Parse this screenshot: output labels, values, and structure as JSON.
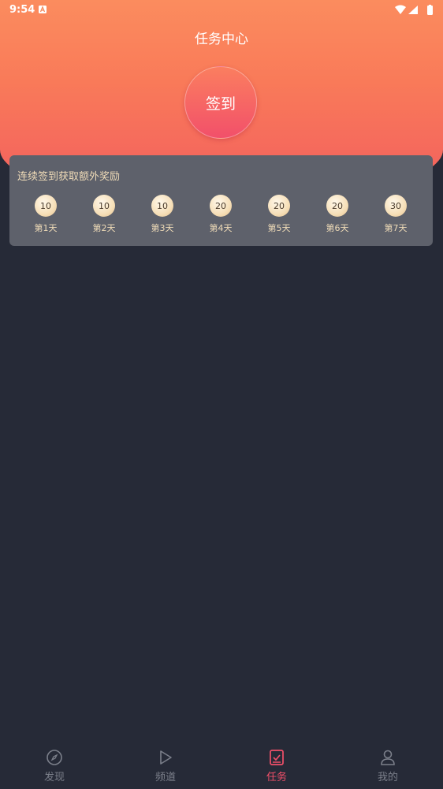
{
  "status": {
    "time": "9:54"
  },
  "header": {
    "title": "任务中心"
  },
  "checkin": {
    "label": "签到"
  },
  "reward_card": {
    "title": "连续签到获取额外奖励",
    "days": [
      {
        "coins": "10",
        "label": "第1天"
      },
      {
        "coins": "10",
        "label": "第2天"
      },
      {
        "coins": "10",
        "label": "第3天"
      },
      {
        "coins": "20",
        "label": "第4天"
      },
      {
        "coins": "20",
        "label": "第5天"
      },
      {
        "coins": "20",
        "label": "第6天"
      },
      {
        "coins": "30",
        "label": "第7天"
      }
    ]
  },
  "tabs": [
    {
      "label": "发现",
      "icon": "compass-icon"
    },
    {
      "label": "频道",
      "icon": "play-icon"
    },
    {
      "label": "任务",
      "icon": "task-check-icon",
      "active": true
    },
    {
      "label": "我的",
      "icon": "user-icon"
    }
  ],
  "colors": {
    "accent": "#f2506a",
    "background": "#262a37",
    "card": "#5e616b",
    "gold": "#f0dcb8"
  }
}
